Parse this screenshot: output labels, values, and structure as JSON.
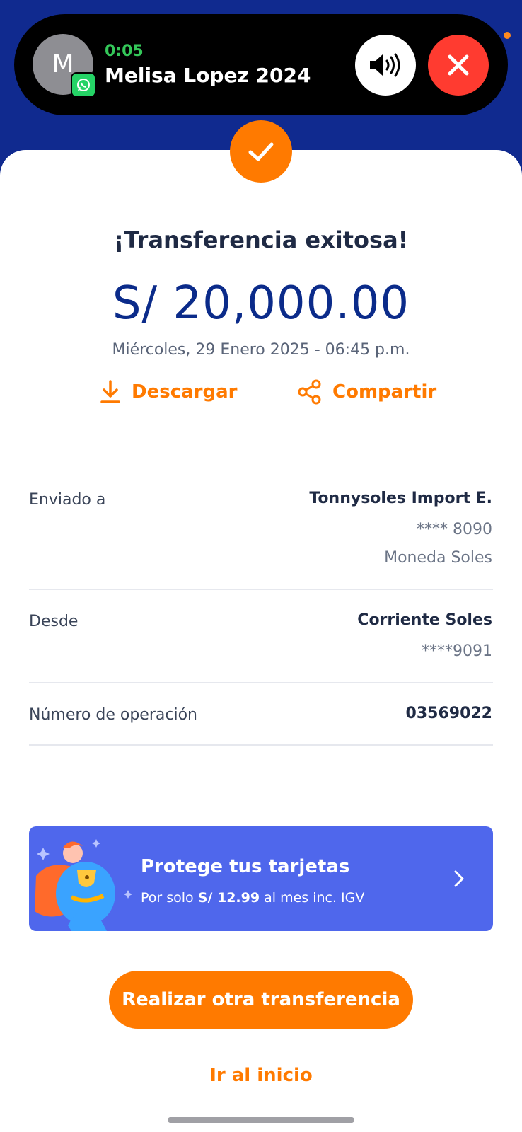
{
  "call": {
    "avatar_initial": "M",
    "timer": "0:05",
    "name": "Melisa Lopez 2024"
  },
  "receipt": {
    "title": "¡Transferencia exitosa!",
    "amount": "S/ 20,000.00",
    "datetime": "Miércoles, 29 Enero 2025 - 06:45 p.m.",
    "download_label": "Descargar",
    "share_label": "Compartir"
  },
  "details": {
    "sent_to_label": "Enviado a",
    "sent_to_name": "Tonnysoles Import E.",
    "sent_to_account": "**** 8090",
    "sent_to_currency": "Moneda Soles",
    "from_label": "Desde",
    "from_account_type": "Corriente Soles",
    "from_account": "****9091",
    "operation_label": "Número de operación",
    "operation_number": "03569022"
  },
  "banner": {
    "title": "Protege tus tarjetas",
    "sub_prefix": "Por solo ",
    "sub_price": "S/ 12.99",
    "sub_suffix": " al mes inc. IGV"
  },
  "buttons": {
    "new_transfer": "Realizar otra transferencia",
    "go_home": "Ir al inicio"
  },
  "colors": {
    "brand_blue": "#102a8f",
    "accent_orange": "#ff7a00",
    "banner_blue": "#4f67ec"
  }
}
